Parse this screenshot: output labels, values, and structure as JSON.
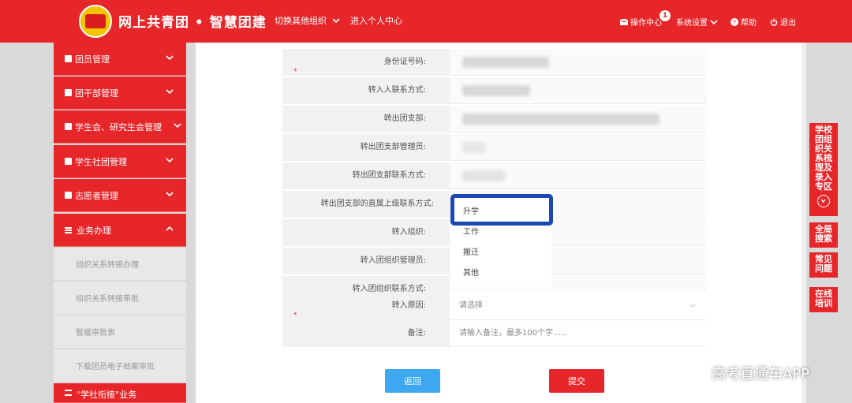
{
  "header": {
    "app_title": "网上共青团 • 智慧团建",
    "switch_org": "切换其他组织",
    "personal_center": "进入个人中心",
    "operations": "操作中心",
    "operations_badge": "1",
    "settings": "系统设置",
    "help": "帮助",
    "logout": "退出"
  },
  "sidebar": {
    "items": [
      {
        "label": "团员管理"
      },
      {
        "label": "团干部管理"
      },
      {
        "label": "学生会、研究生会管理"
      },
      {
        "label": "学生社团管理"
      },
      {
        "label": "志愿者管理"
      },
      {
        "label": "业务办理"
      }
    ],
    "sub_items": [
      {
        "label": "组织关系转接办理"
      },
      {
        "label": "组织关系转接审批"
      },
      {
        "label": "暂缓审批表"
      },
      {
        "label": "下载团员电子档案审批"
      }
    ],
    "bottom_item": "\"学社衔接\"业务"
  },
  "form": {
    "rows": [
      {
        "label": "身份证号码:",
        "value": ""
      },
      {
        "label": "转入人联系方式:",
        "value": ""
      },
      {
        "label": "转出团支部:",
        "value": ""
      },
      {
        "label": "转出团支部管理员:",
        "value": ""
      },
      {
        "label": "转出团支部联系方式:",
        "value": ""
      },
      {
        "label": "转出团支部的直属上级联系方式:",
        "value": ""
      },
      {
        "label": "转入组织:",
        "value": ""
      },
      {
        "label": "转入团组织管理员:",
        "value": ""
      },
      {
        "label": "转入团组织联系方式:",
        "value": ""
      },
      {
        "label": "转入原因:",
        "value": "请选择"
      },
      {
        "label": "备注:",
        "value": "请输入备注，最多100个字......"
      }
    ],
    "required_marker": "*"
  },
  "dropdown": {
    "options": [
      "升学",
      "工作",
      "搬迁",
      "其他"
    ]
  },
  "buttons": {
    "back": "返回",
    "submit": "提交"
  },
  "right_tabs": [
    {
      "label": "学校团组织关系梳理及录入专区"
    },
    {
      "label": "全局搜索"
    },
    {
      "label": "常见问题"
    },
    {
      "label": "在线培训"
    }
  ],
  "watermark": "高考直通车APP",
  "colors": {
    "primary_red": "#e7262a",
    "accent_blue": "#3da7ef",
    "highlight_blue": "#1b49b0"
  }
}
